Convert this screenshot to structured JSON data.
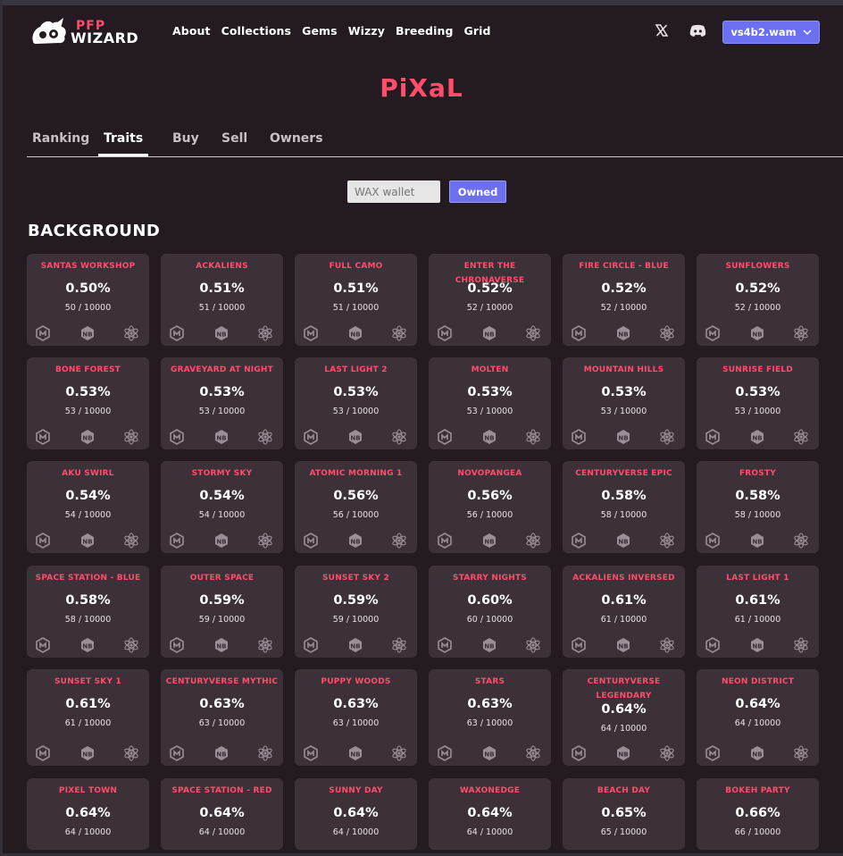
{
  "header": {
    "logo_top": "PFP",
    "logo_bottom": "WIZARD",
    "nav": [
      "About",
      "Collections",
      "Gems",
      "Wizzy",
      "Breeding",
      "Grid"
    ],
    "wallet_label": "vs4b2.wam"
  },
  "page_title": "PiXaL",
  "tabs": [
    "Ranking",
    "Traits",
    "Buy",
    "Sell",
    "Owners"
  ],
  "active_tab": "Traits",
  "filter": {
    "wallet_placeholder": "WAX wallet",
    "owned_label": "Owned"
  },
  "section_title": "BACKGROUND",
  "colors": {
    "accent": "#6c6ff0",
    "brand_red": "#ff4d6a",
    "background": "#241a21",
    "card": "#3c3039"
  },
  "icons": [
    "atomichub-icon",
    "neftyblocks-icon",
    "atom-icon"
  ],
  "traits": [
    {
      "name": "Santas Workshop",
      "pct": "0.50%",
      "count": "50 / 10000"
    },
    {
      "name": "Ackaliens",
      "pct": "0.51%",
      "count": "51 / 10000"
    },
    {
      "name": "Full Camo",
      "pct": "0.51%",
      "count": "51 / 10000"
    },
    {
      "name": "Enter the Chronaverse",
      "pct": "0.52%",
      "count": "52 / 10000"
    },
    {
      "name": "Fire Circle - Blue",
      "pct": "0.52%",
      "count": "52 / 10000"
    },
    {
      "name": "Sunflowers",
      "pct": "0.52%",
      "count": "52 / 10000"
    },
    {
      "name": "Bone Forest",
      "pct": "0.53%",
      "count": "53 / 10000"
    },
    {
      "name": "Graveyard at Night",
      "pct": "0.53%",
      "count": "53 / 10000"
    },
    {
      "name": "Last Light 2",
      "pct": "0.53%",
      "count": "53 / 10000"
    },
    {
      "name": "Molten",
      "pct": "0.53%",
      "count": "53 / 10000"
    },
    {
      "name": "Mountain Hills",
      "pct": "0.53%",
      "count": "53 / 10000"
    },
    {
      "name": "Sunrise Field",
      "pct": "0.53%",
      "count": "53 / 10000"
    },
    {
      "name": "Aku Swirl",
      "pct": "0.54%",
      "count": "54 / 10000"
    },
    {
      "name": "Stormy Sky",
      "pct": "0.54%",
      "count": "54 / 10000"
    },
    {
      "name": "Atomic Morning 1",
      "pct": "0.56%",
      "count": "56 / 10000"
    },
    {
      "name": "Novopangea",
      "pct": "0.56%",
      "count": "56 / 10000"
    },
    {
      "name": "Centuryverse Epic",
      "pct": "0.58%",
      "count": "58 / 10000"
    },
    {
      "name": "Frosty",
      "pct": "0.58%",
      "count": "58 / 10000"
    },
    {
      "name": "Space Station - Blue",
      "pct": "0.58%",
      "count": "58 / 10000"
    },
    {
      "name": "Outer Space",
      "pct": "0.59%",
      "count": "59 / 10000"
    },
    {
      "name": "Sunset Sky 2",
      "pct": "0.59%",
      "count": "59 / 10000"
    },
    {
      "name": "Starry Nights",
      "pct": "0.60%",
      "count": "60 / 10000"
    },
    {
      "name": "Ackaliens Inversed",
      "pct": "0.61%",
      "count": "61 / 10000"
    },
    {
      "name": "Last Light 1",
      "pct": "0.61%",
      "count": "61 / 10000"
    },
    {
      "name": "Sunset Sky 1",
      "pct": "0.61%",
      "count": "61 / 10000"
    },
    {
      "name": "Centuryverse Mythic",
      "pct": "0.63%",
      "count": "63 / 10000"
    },
    {
      "name": "Puppy Woods",
      "pct": "0.63%",
      "count": "63 / 10000"
    },
    {
      "name": "Stars",
      "pct": "0.63%",
      "count": "63 / 10000"
    },
    {
      "name": "Centuryverse Legendary",
      "pct": "0.64%",
      "count": "64 / 10000"
    },
    {
      "name": "Neon District",
      "pct": "0.64%",
      "count": "64 / 10000"
    },
    {
      "name": "Pixel Town",
      "pct": "0.64%",
      "count": "64 / 10000"
    },
    {
      "name": "Space Station - Red",
      "pct": "0.64%",
      "count": "64 / 10000"
    },
    {
      "name": "Sunny Day",
      "pct": "0.64%",
      "count": "64 / 10000"
    },
    {
      "name": "Waxonedge",
      "pct": "0.64%",
      "count": "64 / 10000"
    },
    {
      "name": "Beach Day",
      "pct": "0.65%",
      "count": "65 / 10000"
    },
    {
      "name": "Bokeh Party",
      "pct": "0.66%",
      "count": "66 / 10000"
    }
  ]
}
